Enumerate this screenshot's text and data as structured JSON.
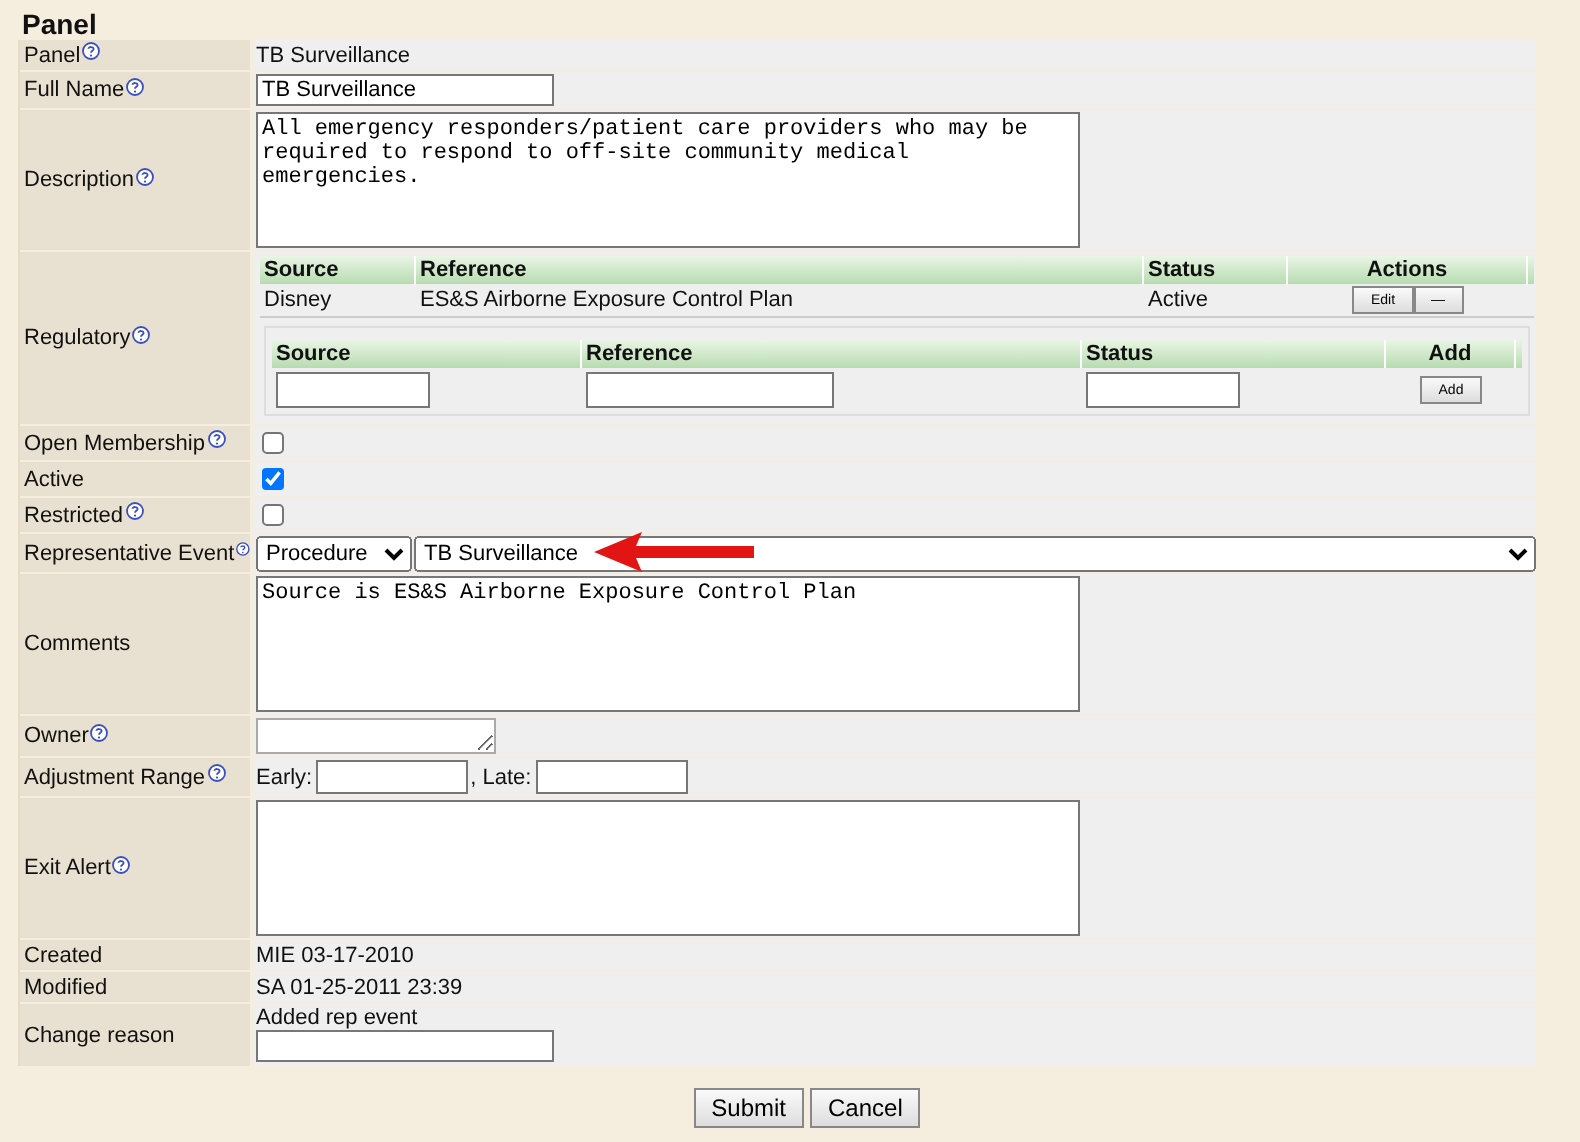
{
  "title": "Panel",
  "fields": [
    {
      "kind": "text",
      "label": "Panel",
      "help": true,
      "value": "TB Surveillance"
    },
    {
      "kind": "input",
      "label": "Full Name",
      "help": true,
      "value": "TB Surveillance"
    },
    {
      "kind": "textarea",
      "label": "Description",
      "help": true,
      "value": "All emergency responders/patient care providers who may be required to respond to off-site community medical emergencies."
    },
    {
      "kind": "regulatory",
      "label": "Regulatory",
      "help": true,
      "columns": [
        "Source",
        "Reference",
        "Status",
        "Actions"
      ],
      "rows": [
        {
          "source": "Disney",
          "reference": "ES&S Airborne Exposure Control Plan",
          "status": "Active",
          "buttons": [
            "Edit",
            "—"
          ]
        }
      ],
      "add_columns": [
        "Source",
        "Reference",
        "Status",
        "Add"
      ],
      "add_button": "Add"
    },
    {
      "kind": "checkbox",
      "label": "Open Membership",
      "help": true,
      "checked": false
    },
    {
      "kind": "checkbox",
      "label": "Active",
      "help": false,
      "checked": true
    },
    {
      "kind": "checkbox",
      "label": "Restricted",
      "help": true,
      "checked": false
    },
    {
      "kind": "event",
      "label": "Representative Event",
      "help": true,
      "type_value": "Procedure",
      "event_value": "TB Surveillance",
      "arrow": true
    },
    {
      "kind": "textarea",
      "label": "Comments",
      "help": false,
      "value": "Source is ES&S Airborne Exposure Control Plan"
    },
    {
      "kind": "smallarea",
      "label": "Owner",
      "help": true
    },
    {
      "kind": "range",
      "label": "Adjustment Range",
      "help": true,
      "early_label": "Early:",
      "late_label": ", Late:"
    },
    {
      "kind": "textarea",
      "label": "Exit Alert",
      "help": true
    },
    {
      "kind": "text",
      "label": "Created",
      "help": false,
      "value": "MIE 03-17-2010"
    },
    {
      "kind": "text",
      "label": "Modified",
      "help": false,
      "value": "SA 01-25-2011 23:39"
    },
    {
      "kind": "reason",
      "label": "Change reason",
      "help": false,
      "value": "Added rep event"
    }
  ],
  "buttons": [
    "Submit",
    "Cancel"
  ]
}
